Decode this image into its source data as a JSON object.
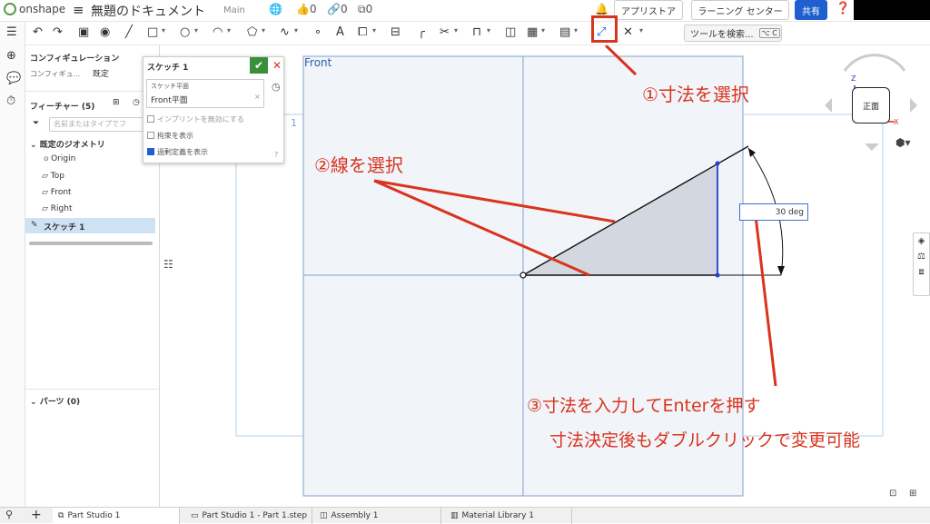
{
  "header": {
    "logo_text": "onshape",
    "menu_icon": "hamburger-icon",
    "document_title": "無題のドキュメント",
    "branch": "Main",
    "likes": "0",
    "links": "0",
    "copies": "0",
    "app_store": "アプリストア",
    "learning_center": "ラーニング センター",
    "share": "共有",
    "help_icon": "help-icon"
  },
  "toolbar": {
    "tool_search_placeholder": "ツールを検索...",
    "tool_search_shortcut": "⌥ C"
  },
  "feature_panel": {
    "configuration_title": "コンフィギュレーション",
    "configuration_label": "コンフィギュ...",
    "configuration_value": "既定",
    "features_title": "フィーチャー (5)",
    "search_placeholder": "名前またはタイプでフ",
    "default_geometry": "既定のジオメトリ",
    "items": [
      "Origin",
      "Top",
      "Front",
      "Right"
    ],
    "sketch_item": "スケッチ 1",
    "parts_title": "パーツ (0)"
  },
  "sketch_dialog": {
    "title": "スケッチ 1",
    "plane_label": "スケッチ平面",
    "plane_value": "Front平面",
    "option_imprint": "インプリントを無効にする",
    "option_constraints": "拘束を表示",
    "option_overdefined": "過剰定義を表示",
    "overdefined_checked": true
  },
  "canvas": {
    "plane_name": "Front",
    "dimension_value": "30 deg",
    "view_cube_label": "正面",
    "axis_x": "X",
    "axis_z": "Z",
    "canvas_corner_label": "1"
  },
  "annotations": {
    "step1": "①寸法を選択",
    "step2": "②線を選択",
    "step3": "③寸法を入力してEnterを押す",
    "step3_note": "寸法決定後もダブルクリックで変更可能",
    "color": "#d9341d"
  },
  "bottom_tabs": [
    {
      "label": "Part Studio 1",
      "icon": "part-studio-icon"
    },
    {
      "label": "Part Studio 1 - Part 1.step",
      "icon": "step-file-icon"
    },
    {
      "label": "Assembly 1",
      "icon": "assembly-icon"
    },
    {
      "label": "Material Library 1",
      "icon": "material-library-icon"
    }
  ]
}
